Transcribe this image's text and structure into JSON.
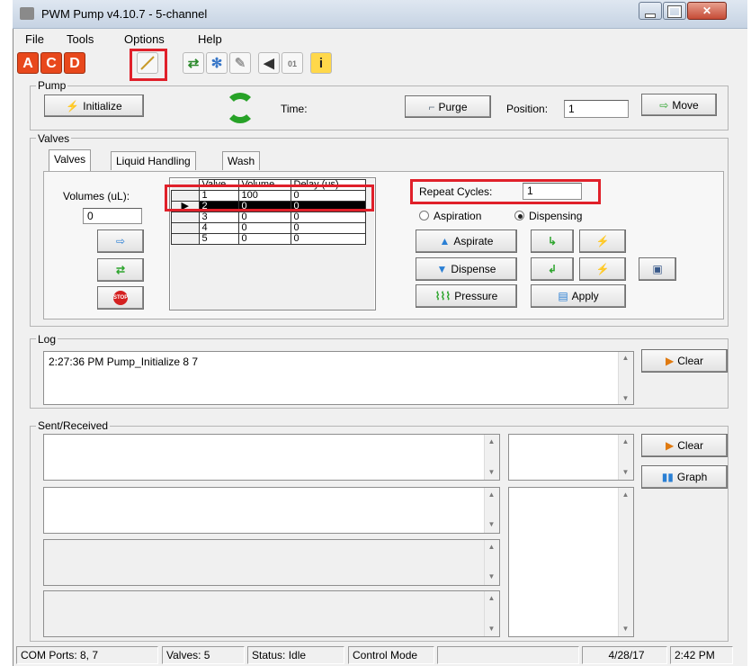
{
  "window": {
    "title": "PWM Pump v4.10.7 - 5-channel"
  },
  "menu": {
    "file": "File",
    "tools": "Tools",
    "options": "Options",
    "help": "Help"
  },
  "toolbar": {
    "a": "A",
    "c": "C",
    "d": "D"
  },
  "pump": {
    "label": "Pump",
    "initialize": "Initialize",
    "time_label": "Time:",
    "purge": "Purge",
    "position_label": "Position:",
    "position_value": "1",
    "move": "Move"
  },
  "valves": {
    "label": "Valves",
    "tabs": [
      "Valves",
      "Liquid Handling",
      "Wash"
    ],
    "volumes_label": "Volumes (uL):",
    "volumes_value": "0",
    "grid_headers": [
      "Valve",
      "Volume",
      "Delay (us)"
    ],
    "grid_rows": [
      [
        "1",
        "100",
        "0"
      ],
      [
        "2",
        "0",
        "0"
      ],
      [
        "3",
        "0",
        "0"
      ],
      [
        "4",
        "0",
        "0"
      ],
      [
        "5",
        "0",
        "0"
      ]
    ],
    "repeat_label": "Repeat Cycles:",
    "repeat_value": "1",
    "aspiration": "Aspiration",
    "dispensing": "Dispensing",
    "aspirate": "Aspirate",
    "dispense": "Dispense",
    "pressure": "Pressure",
    "apply": "Apply"
  },
  "log": {
    "label": "Log",
    "entry": "2:27:36 PM Pump_Initialize 8 7",
    "clear": "Clear"
  },
  "sent": {
    "label": "Sent/Received",
    "clear": "Clear",
    "graph": "Graph"
  },
  "statusbar": {
    "com": "COM Ports: 8, 7",
    "valves": "Valves: 5",
    "status": "Status: Idle",
    "mode": "Control Mode",
    "date": "4/28/17",
    "time": "2:42 PM"
  },
  "colors": {
    "accent_red": "#e0202a",
    "toolbar_orange": "#e8481c"
  }
}
